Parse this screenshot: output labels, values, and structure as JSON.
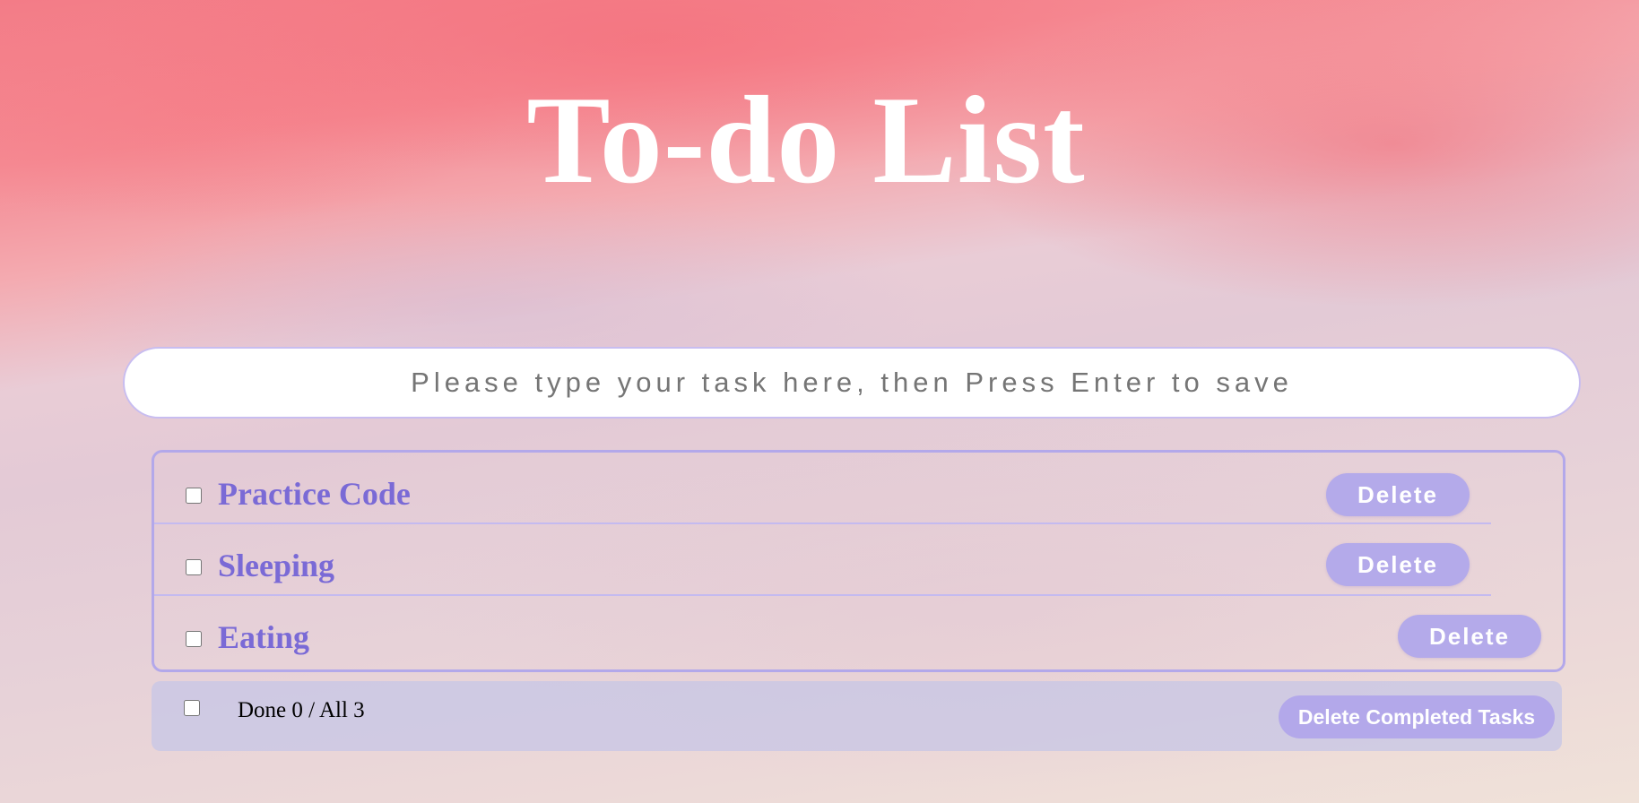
{
  "header": {
    "title": "To-do List"
  },
  "input": {
    "placeholder": "Please type your task here, then Press Enter to save",
    "value": ""
  },
  "tasks": [
    {
      "label": "Practice Code",
      "done": false,
      "delete_label": "Delete"
    },
    {
      "label": "Sleeping",
      "done": false,
      "delete_label": "Delete"
    },
    {
      "label": "Eating",
      "done": false,
      "delete_label": "Delete"
    }
  ],
  "footer": {
    "done_prefix": "Done",
    "done_count": "0",
    "separator": "/ All",
    "total_count": "3",
    "select_all_checked": false,
    "delete_completed_label": "Delete Completed Tasks"
  },
  "colors": {
    "accent": "#b4aaea",
    "task_text": "#7a6ad6",
    "border": "#b3a8ea",
    "title": "#ffffff"
  }
}
